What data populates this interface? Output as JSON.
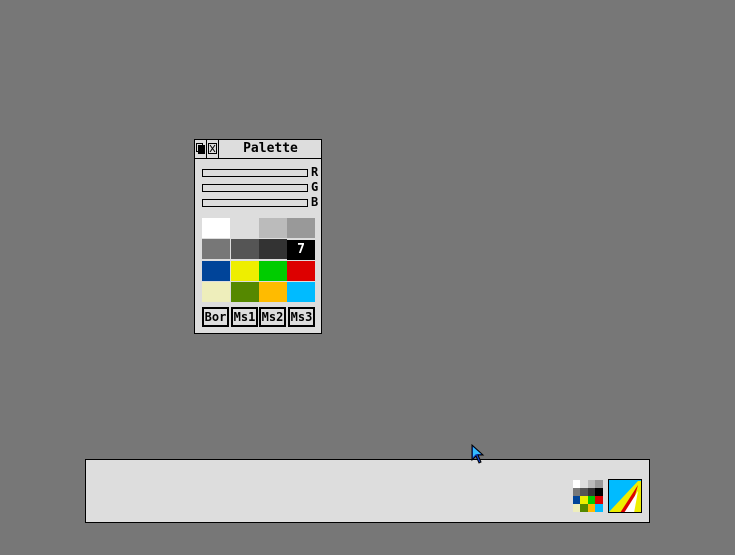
{
  "window": {
    "title": "Palette",
    "buttons": {
      "back_icon": "back-icon",
      "close_icon": "close-icon"
    }
  },
  "sliders": [
    {
      "label": "R",
      "value_fraction": 0
    },
    {
      "label": "G",
      "value_fraction": 0
    },
    {
      "label": "B",
      "value_fraction": 0
    }
  ],
  "swatches": [
    {
      "index": 0,
      "color": "#ffffff"
    },
    {
      "index": 1,
      "color": "#dddddd"
    },
    {
      "index": 2,
      "color": "#bbbbbb"
    },
    {
      "index": 3,
      "color": "#999999"
    },
    {
      "index": 4,
      "color": "#777777"
    },
    {
      "index": 5,
      "color": "#555555"
    },
    {
      "index": 6,
      "color": "#333333"
    },
    {
      "index": 7,
      "color": "#000000",
      "selected": true,
      "label": "7"
    },
    {
      "index": 8,
      "color": "#004499"
    },
    {
      "index": 9,
      "color": "#eeee00"
    },
    {
      "index": 10,
      "color": "#00cc00"
    },
    {
      "index": 11,
      "color": "#dd0000"
    },
    {
      "index": 12,
      "color": "#eeeebb"
    },
    {
      "index": 13,
      "color": "#558800"
    },
    {
      "index": 14,
      "color": "#ffbb00"
    },
    {
      "index": 15,
      "color": "#00bbff"
    }
  ],
  "palette_buttons": [
    "Bor",
    "Ms1",
    "Ms2",
    "Ms3"
  ],
  "iconbar": {
    "icons": [
      "palette-icon",
      "acorn-icon"
    ]
  },
  "pointer": {
    "color": "#1144cc"
  }
}
